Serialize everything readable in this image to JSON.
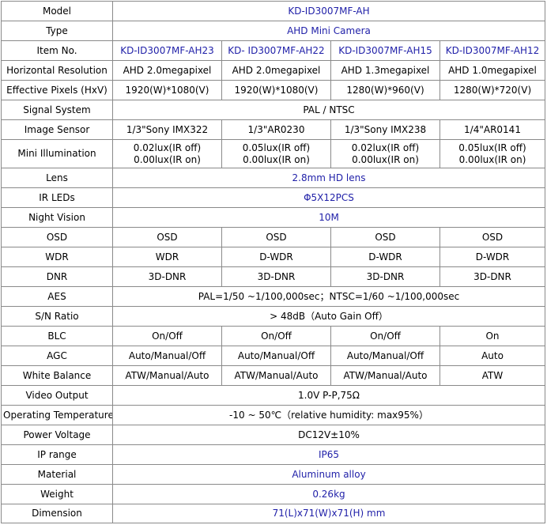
{
  "colors": {
    "accent_text": "#1f1fa8",
    "border": "#8a8a8a"
  },
  "rows": [
    {
      "label": "Model",
      "span": "KD-ID3007MF-AH",
      "blue": true
    },
    {
      "label": "Type",
      "span": "AHD Mini Camera",
      "blue": true
    },
    {
      "label": "Item No.",
      "cells": [
        "KD-ID3007MF-AH23",
        "KD- ID3007MF-AH22",
        "KD-ID3007MF-AH15",
        "KD-ID3007MF-AH12"
      ],
      "blue": true
    },
    {
      "label": "Horizontal Resolution",
      "cells": [
        "AHD 2.0megapixel",
        "AHD 2.0megapixel",
        "AHD 1.3megapixel",
        "AHD 1.0megapixel"
      ]
    },
    {
      "label": "Effective Pixels (HxV)",
      "cells": [
        "1920(W)*1080(V)",
        "1920(W)*1080(V)",
        "1280(W)*960(V)",
        "1280(W)*720(V)"
      ]
    },
    {
      "label": "Signal System",
      "span": "PAL / NTSC"
    },
    {
      "label": "Image Sensor",
      "cells": [
        "1/3\"Sony IMX322",
        "1/3\"AR0230",
        "1/3\"Sony IMX238",
        "1/4\"AR0141"
      ]
    },
    {
      "label": "Mini Illumination",
      "cells2": [
        [
          "0.02lux(IR off)",
          "0.00lux(IR on)"
        ],
        [
          "0.05lux(IR off)",
          "0.00lux(IR on)"
        ],
        [
          "0.02lux(IR off)",
          "0.00lux(IR on)"
        ],
        [
          "0.05lux(IR off)",
          "0.00lux(IR on)"
        ]
      ]
    },
    {
      "label": "Lens",
      "span": "2.8mm HD lens",
      "blue": true
    },
    {
      "label": "IR LEDs",
      "span": "Φ5X12PCS",
      "blue": true
    },
    {
      "label": "Night Vision",
      "span": "10M",
      "blue": true
    },
    {
      "label": "OSD",
      "cells": [
        "OSD",
        "OSD",
        "OSD",
        "OSD"
      ]
    },
    {
      "label": "WDR",
      "cells": [
        "WDR",
        "D-WDR",
        "D-WDR",
        "D-WDR"
      ]
    },
    {
      "label": "DNR",
      "cells": [
        "3D-DNR",
        "3D-DNR",
        "3D-DNR",
        "3D-DNR"
      ]
    },
    {
      "label": "AES",
      "span": "PAL=1/50 ~1/100,000sec；NTSC=1/60 ~1/100,000sec"
    },
    {
      "label": "S/N Ratio",
      "span": "> 48dB（Auto Gain Off）"
    },
    {
      "label": "BLC",
      "cells": [
        "On/Off",
        "On/Off",
        "On/Off",
        "On"
      ]
    },
    {
      "label": "AGC",
      "cells": [
        "Auto/Manual/Off",
        "Auto/Manual/Off",
        "Auto/Manual/Off",
        "Auto"
      ]
    },
    {
      "label": "White Balance",
      "cells": [
        "ATW/Manual/Auto",
        "ATW/Manual/Auto",
        "ATW/Manual/Auto",
        "ATW"
      ]
    },
    {
      "label": "Video Output",
      "span": "1.0V P-P,75Ω"
    },
    {
      "label": "Operating Temperature",
      "span": "-10 ~ 50℃（relative humidity: max95%）"
    },
    {
      "label": "Power Voltage",
      "span": "DC12V±10%"
    },
    {
      "label": "IP range",
      "span": "IP65",
      "blue": true
    },
    {
      "label": "Material",
      "span": "Aluminum alloy",
      "blue": true
    },
    {
      "label": "Weight",
      "span": "0.26kg",
      "blue": true
    },
    {
      "label": "Dimension",
      "span": "71(L)x71(W)x71(H) mm",
      "blue": true
    }
  ]
}
